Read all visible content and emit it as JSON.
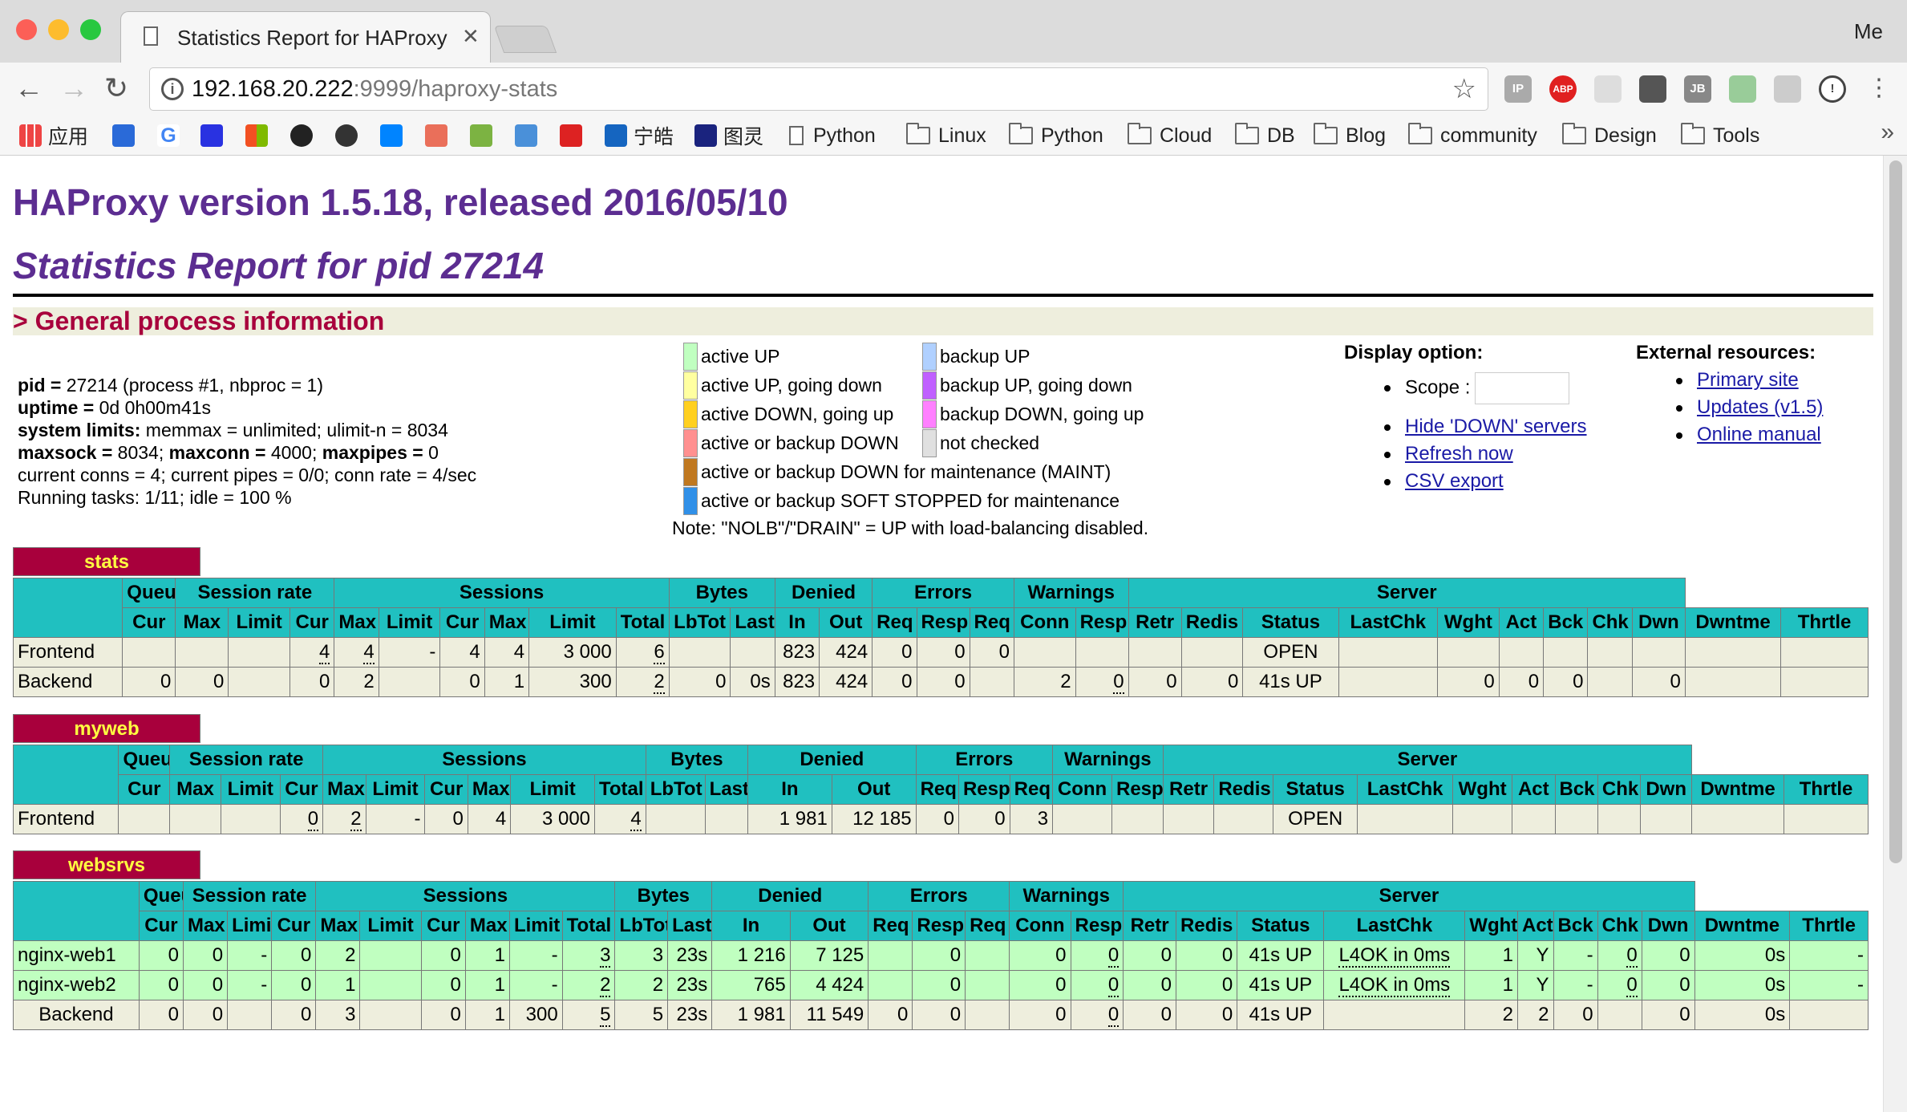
{
  "browser": {
    "tab_title": "Statistics Report for HAProxy",
    "profile": "Me",
    "url_host": "192.168.20.222",
    "url_path": ":9999/haproxy-stats",
    "bookmarks": [
      "应用",
      "宁皓",
      "图灵",
      "Python",
      "Linux",
      "Python",
      "Cloud",
      "DB",
      "Blog",
      "community",
      "Design",
      "Tools"
    ],
    "more": "»"
  },
  "page": {
    "title": "HAProxy version 1.5.18, released 2016/05/10",
    "subtitle": "Statistics Report for pid 27214",
    "general_section": "> General process information",
    "process": {
      "pid_label": "pid = ",
      "pid_value": "27214 (process #1, nbproc = 1)",
      "uptime_label": "uptime = ",
      "uptime_value": "0d 0h00m41s",
      "limits_label": "system limits:",
      "limits_value": " memmax = unlimited; ulimit-n = 8034",
      "maxsock_label": "maxsock = ",
      "maxsock_value": "8034; ",
      "maxconn_label": "maxconn = ",
      "maxconn_value": "4000; ",
      "maxpipes_label": "maxpipes = ",
      "maxpipes_value": "0",
      "current": "current conns = 4; current pipes = 0/0; conn rate = 4/sec",
      "tasks": "Running tasks: 1/11; idle = 100 %"
    },
    "legend": [
      {
        "text": "active UP",
        "color": "#c0ffc0"
      },
      {
        "text": "active UP, going down",
        "color": "#ffffa0"
      },
      {
        "text": "active DOWN, going up",
        "color": "#ffd020"
      },
      {
        "text": "active or backup DOWN",
        "color": "#ff9090"
      },
      {
        "text": "active or backup DOWN for maintenance (MAINT)",
        "color": "#c07820"
      },
      {
        "text": "active or backup SOFT STOPPED for maintenance",
        "color": "#3090e8"
      },
      {
        "text": "backup UP",
        "color": "#b0d0ff"
      },
      {
        "text": "backup UP, going down",
        "color": "#c060ff"
      },
      {
        "text": "backup DOWN, going up",
        "color": "#ff80ff"
      },
      {
        "text": "not checked",
        "color": "#e0e0e0"
      }
    ],
    "note": "Note: \"NOLB\"/\"DRAIN\" = UP with load-balancing disabled.",
    "display": {
      "header": "Display option:",
      "scope_label": "Scope :",
      "hide_down": "Hide 'DOWN' servers",
      "refresh": "Refresh now",
      "csv": "CSV export"
    },
    "external": {
      "header": "External resources:",
      "primary": "Primary site",
      "updates": "Updates (v1.5)",
      "manual": "Online manual"
    }
  },
  "table_headers": {
    "groups": [
      "Queue",
      "Session rate",
      "Sessions",
      "Bytes",
      "Denied",
      "Errors",
      "Warnings",
      "Server"
    ],
    "cols": [
      "Cur",
      "Max",
      "Limit",
      "Cur",
      "Max",
      "Limit",
      "Cur",
      "Max",
      "Limit",
      "Total",
      "LbTot",
      "Last",
      "In",
      "Out",
      "Req",
      "Resp",
      "Req",
      "Conn",
      "Resp",
      "Retr",
      "Redis",
      "Status",
      "LastChk",
      "Wght",
      "Act",
      "Bck",
      "Chk",
      "Dwn",
      "Dwntme",
      "Thrtle"
    ]
  },
  "proxies": [
    {
      "name": "stats",
      "rows": [
        {
          "type": "fe",
          "cells": [
            "Frontend",
            "",
            "",
            "",
            "4",
            "4",
            "-",
            "4",
            "4",
            "3 000",
            "6",
            "",
            "",
            "823",
            "424",
            "0",
            "0",
            "0",
            "",
            "",
            "",
            "",
            "OPEN",
            "",
            "",
            "",
            "",
            "",
            "",
            "",
            ""
          ]
        },
        {
          "type": "be",
          "cells": [
            "Backend",
            "0",
            "0",
            "",
            "0",
            "2",
            "",
            "0",
            "1",
            "300",
            "2",
            "0",
            "0s",
            "823",
            "424",
            "0",
            "0",
            "",
            "2",
            "0",
            "0",
            "0",
            "41s UP",
            "",
            "0",
            "0",
            "0",
            "",
            "0",
            "",
            ""
          ]
        }
      ]
    },
    {
      "name": "myweb",
      "rows": [
        {
          "type": "fe",
          "cells": [
            "Frontend",
            "",
            "",
            "",
            "0",
            "2",
            "-",
            "0",
            "4",
            "3 000",
            "4",
            "",
            "",
            "1 981",
            "12 185",
            "0",
            "0",
            "3",
            "",
            "",
            "",
            "",
            "OPEN",
            "",
            "",
            "",
            "",
            "",
            "",
            "",
            ""
          ]
        }
      ]
    },
    {
      "name": "websrvs",
      "rows": [
        {
          "type": "up",
          "cells": [
            "nginx-web1",
            "0",
            "0",
            "-",
            "0",
            "2",
            "",
            "0",
            "1",
            "-",
            "3",
            "3",
            "23s",
            "1 216",
            "7 125",
            "",
            "0",
            "",
            "0",
            "0",
            "0",
            "0",
            "41s UP",
            "L4OK in 0ms",
            "1",
            "Y",
            "-",
            "0",
            "0",
            "0s",
            "-"
          ]
        },
        {
          "type": "up",
          "cells": [
            "nginx-web2",
            "0",
            "0",
            "-",
            "0",
            "1",
            "",
            "0",
            "1",
            "-",
            "2",
            "2",
            "23s",
            "765",
            "4 424",
            "",
            "0",
            "",
            "0",
            "0",
            "0",
            "0",
            "41s UP",
            "L4OK in 0ms",
            "1",
            "Y",
            "-",
            "0",
            "0",
            "0s",
            "-"
          ]
        },
        {
          "type": "be",
          "cells": [
            "Backend",
            "0",
            "0",
            "",
            "0",
            "3",
            "",
            "0",
            "1",
            "300",
            "5",
            "5",
            "23s",
            "1 981",
            "11 549",
            "0",
            "0",
            "",
            "0",
            "0",
            "0",
            "0",
            "41s UP",
            "",
            "2",
            "2",
            "0",
            "",
            "0",
            "0s",
            ""
          ]
        }
      ]
    }
  ],
  "colors": {
    "title": "#5c2d91",
    "section": "#a8003c",
    "header": "#20c0c0",
    "row": "#eeeedd",
    "up": "#c0ffc0"
  }
}
